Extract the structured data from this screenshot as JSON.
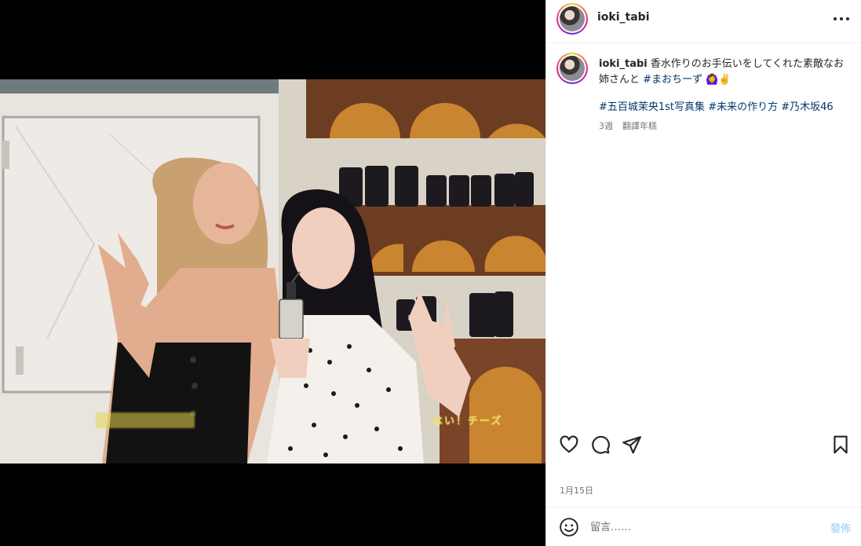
{
  "post": {
    "username": "ioki_tabi",
    "caption": "香水作りのお手伝いをしてくれた素敵なお姉さんと",
    "caption_hashtag": "#まおちーず",
    "caption_emoji": "🙆‍♀️✌️",
    "hashtags": [
      "#五百城茉央1st写真集",
      "#未来の作り方",
      "#乃木坂46"
    ],
    "time_ago": "3週",
    "translate_label": "翻譯年糕",
    "date": "1月15日",
    "comment_placeholder": "留言……",
    "post_button": "發佈"
  },
  "photo": {
    "caption_right": "はい！チーズ"
  },
  "icons": {
    "more": "more-horizontal-icon",
    "like": "heart-icon",
    "comment": "comment-bubble-icon",
    "share": "paper-plane-icon",
    "save": "bookmark-icon",
    "emoji": "smiley-icon"
  },
  "colors": {
    "hashtag": "#00376b",
    "text": "#262626",
    "secondary": "#737373",
    "post_button_disabled": "#b3dbff",
    "photo_shelf_wood": "#c98a34"
  }
}
